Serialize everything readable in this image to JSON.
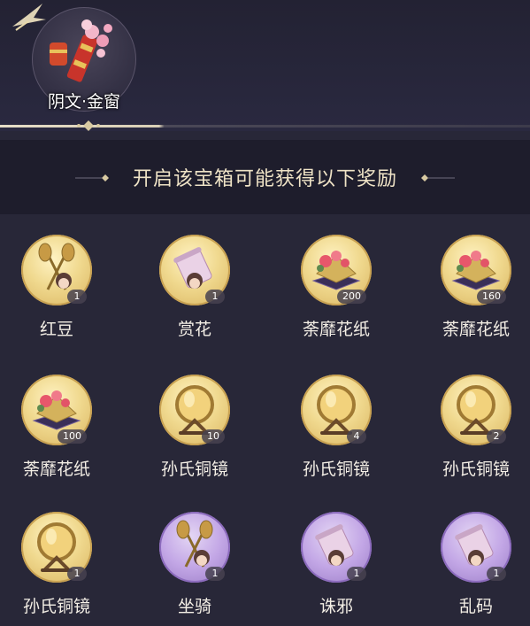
{
  "chest": {
    "name": "阴文·金窗"
  },
  "banner": {
    "title": "开启该宝箱可能获得以下奖励"
  },
  "colors": {
    "bg": "#282738",
    "banner_bg": "#1e1d2c",
    "gold_frame": "#d9b45f",
    "purple_frame": "#9a7cc6",
    "title_text": "#efe3c6"
  },
  "rewards": [
    {
      "name": "红豆",
      "count": "1",
      "frame": "gold",
      "icon": "paddle-fan-icon"
    },
    {
      "name": "赏花",
      "count": "1",
      "frame": "gold",
      "icon": "scroll-icon"
    },
    {
      "name": "荼靡花纸",
      "count": "200",
      "frame": "gold",
      "icon": "flower-paper-icon"
    },
    {
      "name": "荼靡花纸",
      "count": "160",
      "frame": "gold",
      "icon": "flower-paper-icon"
    },
    {
      "name": "荼靡花纸",
      "count": "100",
      "frame": "gold",
      "icon": "flower-paper-icon"
    },
    {
      "name": "孙氏铜镜",
      "count": "10",
      "frame": "gold",
      "icon": "bronze-mirror-icon"
    },
    {
      "name": "孙氏铜镜",
      "count": "4",
      "frame": "gold",
      "icon": "bronze-mirror-icon"
    },
    {
      "name": "孙氏铜镜",
      "count": "2",
      "frame": "gold",
      "icon": "bronze-mirror-icon"
    },
    {
      "name": "孙氏铜镜",
      "count": "1",
      "frame": "gold",
      "icon": "bronze-mirror-icon"
    },
    {
      "name": "坐骑",
      "count": "1",
      "frame": "purple",
      "icon": "paddle-fan-icon"
    },
    {
      "name": "诛邪",
      "count": "1",
      "frame": "purple",
      "icon": "scroll-icon"
    },
    {
      "name": "乱码",
      "count": "1",
      "frame": "purple",
      "icon": "scroll-icon"
    }
  ]
}
